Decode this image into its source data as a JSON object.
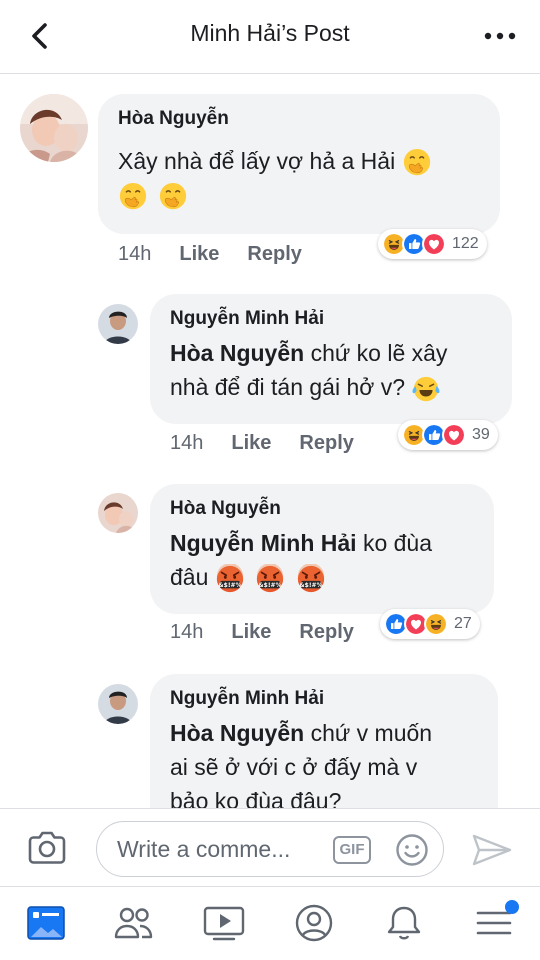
{
  "header": {
    "title": "Minh Hải’s Post",
    "back_icon": "chevron-left-icon",
    "more_icon": "more-horizontal-icon"
  },
  "comments": [
    {
      "author": "Hòa Nguyễn",
      "text": "Xây nhà để lấy vợ hả a Hải",
      "emojis": [
        "face-with-hand-over-mouth",
        "face-with-hand-over-mouth",
        "face-with-hand-over-mouth"
      ],
      "time": "14h",
      "like": "Like",
      "reply": "Reply",
      "reactions": [
        "haha",
        "like",
        "love"
      ],
      "reaction_count": "122"
    },
    {
      "author": "Nguyễn Minh Hải",
      "mention": "Hòa Nguyễn",
      "text_line1": " chứ ko lẽ xây",
      "text_line2": "nhà để đi tán gái hở v?",
      "emojis": [
        "tears-of-joy"
      ],
      "time": "14h",
      "like": "Like",
      "reply": "Reply",
      "reactions": [
        "haha",
        "like",
        "love"
      ],
      "reaction_count": "39"
    },
    {
      "author": "Hòa Nguyễn",
      "mention": "Nguyễn Minh Hải",
      "text_line1": " ko đùa",
      "text_line2": "đâu",
      "emojis": [
        "face-with-symbols-on-mouth",
        "face-with-symbols-on-mouth",
        "face-with-symbols-on-mouth"
      ],
      "time": "14h",
      "like": "Like",
      "reply": "Reply",
      "reactions": [
        "like",
        "love",
        "haha"
      ],
      "reaction_count": "27"
    },
    {
      "author": "Nguyễn Minh Hải",
      "mention": "Hòa Nguyễn",
      "text_line1": " chứ v muốn",
      "text_line2": "ai sẽ ở với c ở đấy mà v",
      "text_line3": "bảo ko đùa đâu?"
    }
  ],
  "composer": {
    "placeholder": "Write a comme...",
    "gif_label": "GIF",
    "camera_icon": "camera-icon",
    "smiley_icon": "smiley-icon",
    "send_icon": "send-icon"
  },
  "nav": {
    "tabs": [
      "news-feed-icon",
      "friends-icon",
      "watch-icon",
      "profile-icon",
      "notifications-icon",
      "menu-icon"
    ],
    "active_color": "#1877f2",
    "inactive_color": "#606770"
  },
  "colors": {
    "accent": "#1877f2",
    "love": "#f33e58",
    "haha": "#f7b125",
    "bubble": "#f2f3f5"
  }
}
